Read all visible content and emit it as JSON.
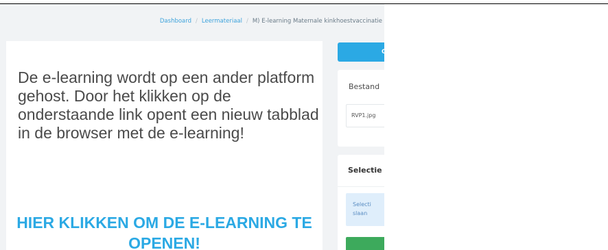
{
  "breadcrumb": {
    "items": [
      "Dashboard",
      "Leermateriaal",
      "M) E-learning Maternale kinkhoestvaccinatie"
    ],
    "separator": "/"
  },
  "main": {
    "intro": "De e-learning wordt op een ander platform gehost. Door het klikken op de onderstaande link opent een nieuw tabblad in de browser met de e-learning!",
    "link_text": "HIER KLIKKEN OM DE E-LEARNING TE OPENEN!"
  },
  "sidebar": {
    "button_fragment": "O",
    "files_title_fragment": "Bestand",
    "file_name": "RVP1.jpg",
    "selection_title_fragment": "Selectie",
    "info_line1_fragment": "Selecti",
    "info_line2_fragment": "slaan"
  },
  "colors": {
    "link": "#2ba9e4",
    "primary_button": "#2ba9e4",
    "success_button": "#3daa5c",
    "info_box": "#dfeefb",
    "page_background": "#f1f3f5"
  }
}
